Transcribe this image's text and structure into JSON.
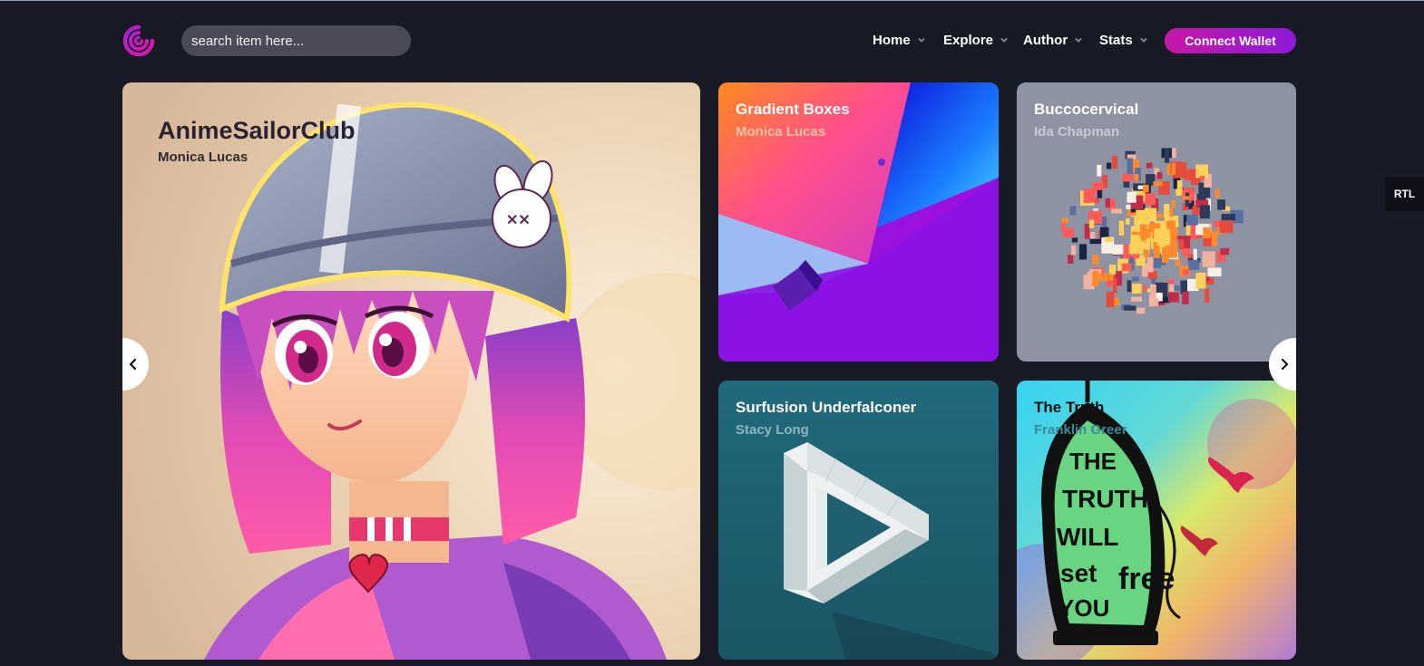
{
  "header": {
    "logo_icon": "spiral-logo-icon",
    "search_placeholder": "search item here...",
    "nav": [
      {
        "label": "Home",
        "icon": "chevron-down-icon"
      },
      {
        "label": "Explore",
        "icon": "chevron-down-icon"
      },
      {
        "label": "Author",
        "icon": "chevron-down-icon"
      },
      {
        "label": "Stats",
        "icon": "chevron-down-icon"
      }
    ],
    "connect_wallet": "Connect Wallet",
    "rtl_label": "RTL"
  },
  "featured": {
    "title": "AnimeSailorClub",
    "author": "Monica Lucas"
  },
  "cards": [
    {
      "title": "Gradient Boxes",
      "author": "Monica Lucas"
    },
    {
      "title": "Buccocervical",
      "author": "Ida Chapman"
    },
    {
      "title": "Surfusion Underfalconer",
      "author": "Stacy Long"
    },
    {
      "title": "The Truth",
      "author": "Franklin Greer"
    }
  ],
  "truth_art_lines": [
    "THE",
    "TRUTH",
    "WILL",
    "set",
    "YOU",
    "free"
  ],
  "carousel": {
    "prev_icon": "chevron-left-icon",
    "next_icon": "chevron-right-icon"
  },
  "colors": {
    "background": "#181a26",
    "accent_start": "#c718a8",
    "accent_end": "#8c1bd8"
  }
}
